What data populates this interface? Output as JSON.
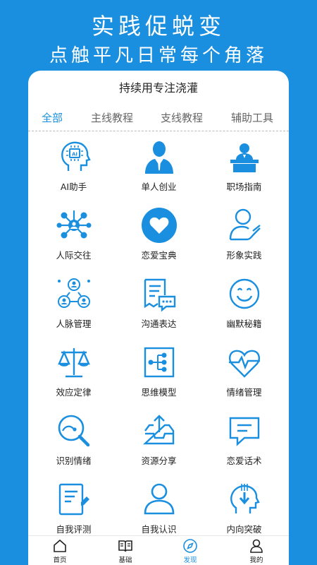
{
  "header": {
    "title": "实践促蜕变",
    "subtitle": "点触平凡日常每个角落"
  },
  "card": {
    "title": "持续用专注浇灌"
  },
  "tabs": [
    {
      "label": "全部",
      "active": true
    },
    {
      "label": "主线教程",
      "active": false
    },
    {
      "label": "支线教程",
      "active": false
    },
    {
      "label": "辅助工具",
      "active": false
    }
  ],
  "items": [
    {
      "label": "AI助手",
      "icon": "ai-head-icon"
    },
    {
      "label": "单人创业",
      "icon": "businessman-icon"
    },
    {
      "label": "职场指南",
      "icon": "speaker-podium-icon"
    },
    {
      "label": "人际交往",
      "icon": "network-icon"
    },
    {
      "label": "恋爱宝典",
      "icon": "heart-icon"
    },
    {
      "label": "形象实践",
      "icon": "person-pen-icon"
    },
    {
      "label": "人脉管理",
      "icon": "contacts-icon"
    },
    {
      "label": "沟通表达",
      "icon": "chat-document-icon"
    },
    {
      "label": "幽默秘籍",
      "icon": "smile-icon"
    },
    {
      "label": "效应定律",
      "icon": "scale-icon"
    },
    {
      "label": "思维模型",
      "icon": "mind-map-icon"
    },
    {
      "label": "情绪管理",
      "icon": "heartbeat-icon"
    },
    {
      "label": "识别情绪",
      "icon": "magnifier-icon"
    },
    {
      "label": "资源分享",
      "icon": "share-box-icon"
    },
    {
      "label": "恋爱话术",
      "icon": "message-icon"
    },
    {
      "label": "自我评测",
      "icon": "test-pen-icon"
    },
    {
      "label": "自我认识",
      "icon": "user-icon"
    },
    {
      "label": "内向突破",
      "icon": "head-download-icon"
    }
  ],
  "bottom_nav": [
    {
      "label": "首页",
      "icon": "home-icon",
      "active": false
    },
    {
      "label": "基础",
      "icon": "book-icon",
      "active": false
    },
    {
      "label": "发现",
      "icon": "compass-icon",
      "active": true
    },
    {
      "label": "我的",
      "icon": "profile-icon",
      "active": false
    }
  ],
  "colors": {
    "accent": "#1a8fe0",
    "background": "#1a8fe0",
    "text": "#222222"
  }
}
